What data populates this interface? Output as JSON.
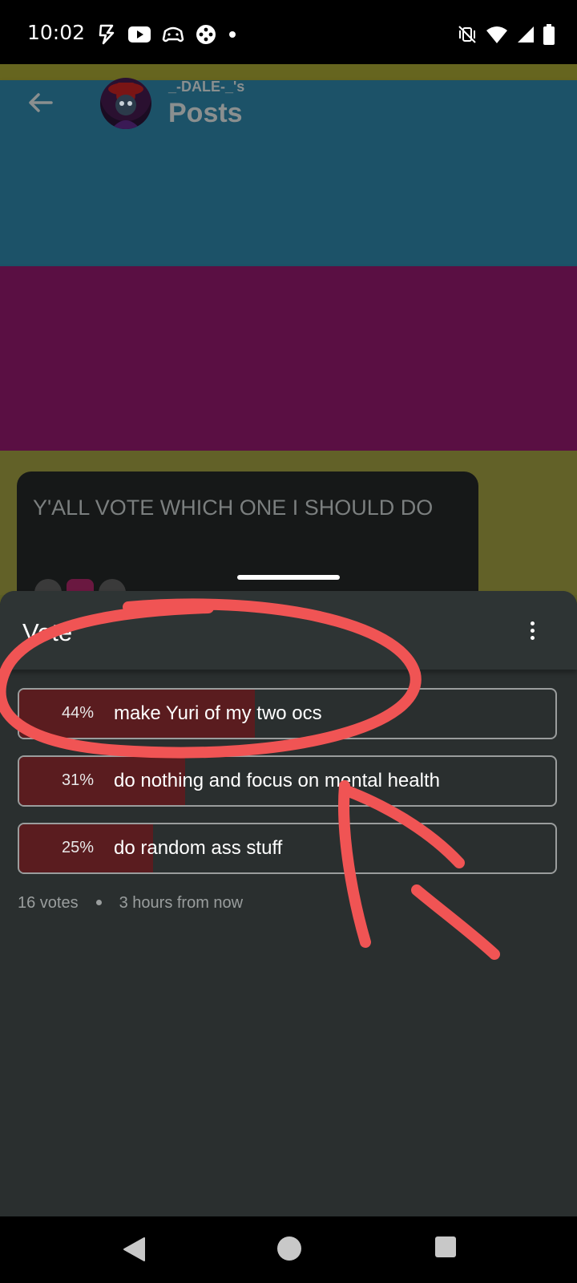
{
  "status_bar": {
    "time": "10:02",
    "icons_left": [
      "lightning-app-icon",
      "youtube-icon",
      "game-controller-icon",
      "games-app-icon",
      "dot-icon"
    ],
    "icons_right": [
      "vibrate-off-icon",
      "wifi-icon",
      "signal-icon",
      "battery-icon"
    ]
  },
  "header": {
    "username": "_-DALE-_'s",
    "title": "Posts"
  },
  "post": {
    "title": "Y'ALL VOTE WHICH ONE I SHOULD DO"
  },
  "sheet": {
    "title": "Vote",
    "options": [
      {
        "percent_label": "44%",
        "percent": 44,
        "label": "make Yuri of my two ocs"
      },
      {
        "percent_label": "31%",
        "percent": 31,
        "label": "do nothing and focus on mental health"
      },
      {
        "percent_label": "25%",
        "percent": 25,
        "label": "do random ass stuff"
      }
    ],
    "votes": "16 votes",
    "time_left": "3 hours from now"
  },
  "colors": {
    "sheet_bg": "#2a2f2f",
    "fill": "#5a1c1f",
    "annotation": "#f05454"
  }
}
